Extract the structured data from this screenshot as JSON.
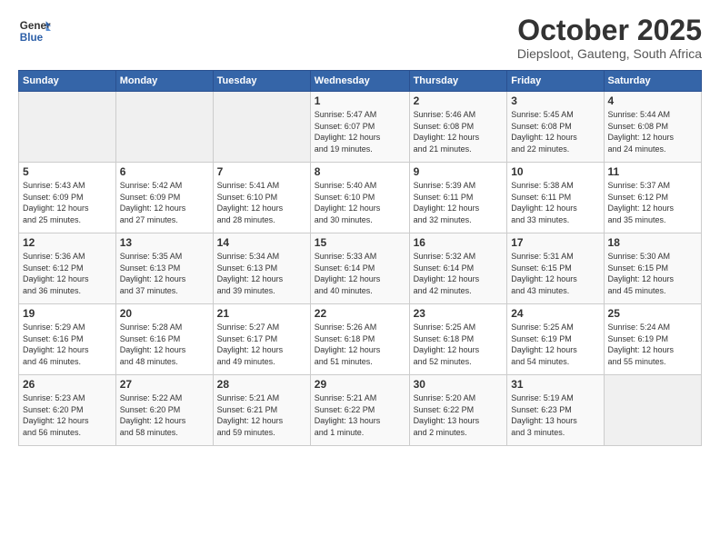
{
  "header": {
    "logo_general": "General",
    "logo_blue": "Blue",
    "month": "October 2025",
    "location": "Diepsloot, Gauteng, South Africa"
  },
  "weekdays": [
    "Sunday",
    "Monday",
    "Tuesday",
    "Wednesday",
    "Thursday",
    "Friday",
    "Saturday"
  ],
  "weeks": [
    [
      {
        "day": "",
        "info": ""
      },
      {
        "day": "",
        "info": ""
      },
      {
        "day": "",
        "info": ""
      },
      {
        "day": "1",
        "info": "Sunrise: 5:47 AM\nSunset: 6:07 PM\nDaylight: 12 hours\nand 19 minutes."
      },
      {
        "day": "2",
        "info": "Sunrise: 5:46 AM\nSunset: 6:08 PM\nDaylight: 12 hours\nand 21 minutes."
      },
      {
        "day": "3",
        "info": "Sunrise: 5:45 AM\nSunset: 6:08 PM\nDaylight: 12 hours\nand 22 minutes."
      },
      {
        "day": "4",
        "info": "Sunrise: 5:44 AM\nSunset: 6:08 PM\nDaylight: 12 hours\nand 24 minutes."
      }
    ],
    [
      {
        "day": "5",
        "info": "Sunrise: 5:43 AM\nSunset: 6:09 PM\nDaylight: 12 hours\nand 25 minutes."
      },
      {
        "day": "6",
        "info": "Sunrise: 5:42 AM\nSunset: 6:09 PM\nDaylight: 12 hours\nand 27 minutes."
      },
      {
        "day": "7",
        "info": "Sunrise: 5:41 AM\nSunset: 6:10 PM\nDaylight: 12 hours\nand 28 minutes."
      },
      {
        "day": "8",
        "info": "Sunrise: 5:40 AM\nSunset: 6:10 PM\nDaylight: 12 hours\nand 30 minutes."
      },
      {
        "day": "9",
        "info": "Sunrise: 5:39 AM\nSunset: 6:11 PM\nDaylight: 12 hours\nand 32 minutes."
      },
      {
        "day": "10",
        "info": "Sunrise: 5:38 AM\nSunset: 6:11 PM\nDaylight: 12 hours\nand 33 minutes."
      },
      {
        "day": "11",
        "info": "Sunrise: 5:37 AM\nSunset: 6:12 PM\nDaylight: 12 hours\nand 35 minutes."
      }
    ],
    [
      {
        "day": "12",
        "info": "Sunrise: 5:36 AM\nSunset: 6:12 PM\nDaylight: 12 hours\nand 36 minutes."
      },
      {
        "day": "13",
        "info": "Sunrise: 5:35 AM\nSunset: 6:13 PM\nDaylight: 12 hours\nand 37 minutes."
      },
      {
        "day": "14",
        "info": "Sunrise: 5:34 AM\nSunset: 6:13 PM\nDaylight: 12 hours\nand 39 minutes."
      },
      {
        "day": "15",
        "info": "Sunrise: 5:33 AM\nSunset: 6:14 PM\nDaylight: 12 hours\nand 40 minutes."
      },
      {
        "day": "16",
        "info": "Sunrise: 5:32 AM\nSunset: 6:14 PM\nDaylight: 12 hours\nand 42 minutes."
      },
      {
        "day": "17",
        "info": "Sunrise: 5:31 AM\nSunset: 6:15 PM\nDaylight: 12 hours\nand 43 minutes."
      },
      {
        "day": "18",
        "info": "Sunrise: 5:30 AM\nSunset: 6:15 PM\nDaylight: 12 hours\nand 45 minutes."
      }
    ],
    [
      {
        "day": "19",
        "info": "Sunrise: 5:29 AM\nSunset: 6:16 PM\nDaylight: 12 hours\nand 46 minutes."
      },
      {
        "day": "20",
        "info": "Sunrise: 5:28 AM\nSunset: 6:16 PM\nDaylight: 12 hours\nand 48 minutes."
      },
      {
        "day": "21",
        "info": "Sunrise: 5:27 AM\nSunset: 6:17 PM\nDaylight: 12 hours\nand 49 minutes."
      },
      {
        "day": "22",
        "info": "Sunrise: 5:26 AM\nSunset: 6:18 PM\nDaylight: 12 hours\nand 51 minutes."
      },
      {
        "day": "23",
        "info": "Sunrise: 5:25 AM\nSunset: 6:18 PM\nDaylight: 12 hours\nand 52 minutes."
      },
      {
        "day": "24",
        "info": "Sunrise: 5:25 AM\nSunset: 6:19 PM\nDaylight: 12 hours\nand 54 minutes."
      },
      {
        "day": "25",
        "info": "Sunrise: 5:24 AM\nSunset: 6:19 PM\nDaylight: 12 hours\nand 55 minutes."
      }
    ],
    [
      {
        "day": "26",
        "info": "Sunrise: 5:23 AM\nSunset: 6:20 PM\nDaylight: 12 hours\nand 56 minutes."
      },
      {
        "day": "27",
        "info": "Sunrise: 5:22 AM\nSunset: 6:20 PM\nDaylight: 12 hours\nand 58 minutes."
      },
      {
        "day": "28",
        "info": "Sunrise: 5:21 AM\nSunset: 6:21 PM\nDaylight: 12 hours\nand 59 minutes."
      },
      {
        "day": "29",
        "info": "Sunrise: 5:21 AM\nSunset: 6:22 PM\nDaylight: 13 hours\nand 1 minute."
      },
      {
        "day": "30",
        "info": "Sunrise: 5:20 AM\nSunset: 6:22 PM\nDaylight: 13 hours\nand 2 minutes."
      },
      {
        "day": "31",
        "info": "Sunrise: 5:19 AM\nSunset: 6:23 PM\nDaylight: 13 hours\nand 3 minutes."
      },
      {
        "day": "",
        "info": ""
      }
    ]
  ]
}
